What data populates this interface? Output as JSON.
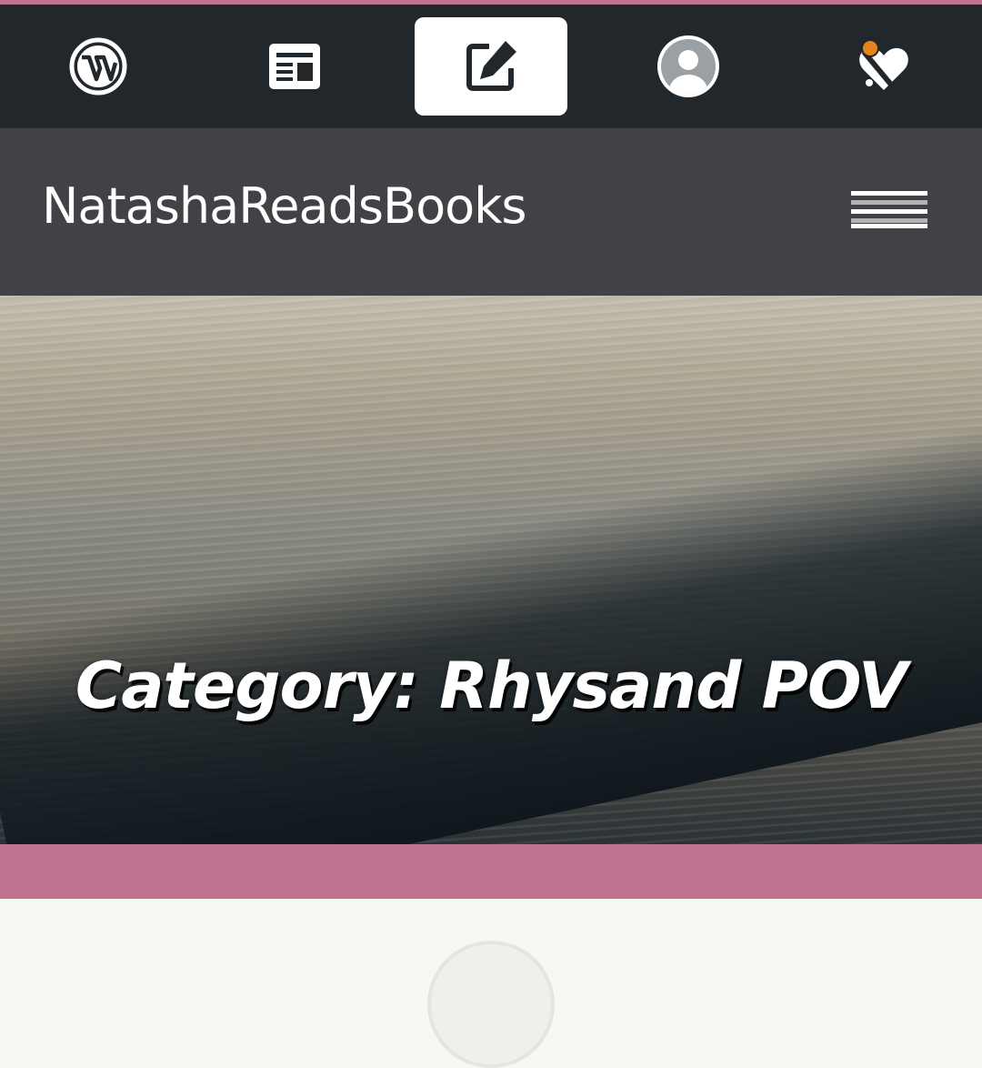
{
  "toolbar": {
    "items": [
      {
        "icon": "wordpress-logo-icon",
        "label": "My Sites"
      },
      {
        "icon": "reader-icon",
        "label": "Reader"
      },
      {
        "icon": "write-icon",
        "label": "Write",
        "active": true
      },
      {
        "icon": "profile-icon",
        "label": "Me"
      },
      {
        "icon": "notifications-icon",
        "label": "Notifications",
        "unread": true
      }
    ]
  },
  "site": {
    "title": "NatashaReadsBooks",
    "menu_icon": "hamburger-menu-icon"
  },
  "hero": {
    "heading": "Category: Rhysand POV"
  },
  "colors": {
    "toolbar_bg": "#22272c",
    "header_bg": "#414146",
    "accent_pink": "#c07390",
    "notification_dot": "#e8821e",
    "content_bg": "#f7f7f3"
  }
}
